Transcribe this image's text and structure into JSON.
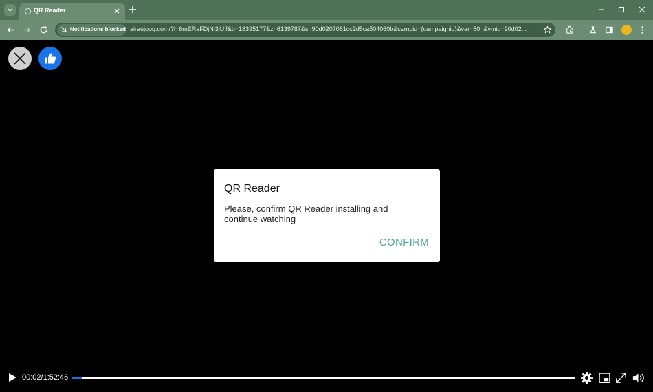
{
  "browser": {
    "tab_title": "QR Reader",
    "notification_chip": "Notifications blocked",
    "url": "airaujoog.com/?l=6mERaFDjNi3jUfl&b=18395177&z=6139787&s=90d0207061cc2d5ca504060b&campid={campaignid}&var=80_&ymid=90d02...",
    "icons": [
      "tab-search-icon",
      "close-icon",
      "plus-icon",
      "minimize-icon",
      "maximize-icon",
      "window-close-icon",
      "back-icon",
      "forward-icon",
      "reload-icon",
      "bell-off-icon",
      "star-icon",
      "extensions-icon",
      "labs-icon",
      "side-panel-icon",
      "menu-icon"
    ]
  },
  "page": {
    "close_icon": "close-icon",
    "like_icon": "thumbs-up-icon"
  },
  "dialog": {
    "title": "QR Reader",
    "body": "Please, confirm QR Reader installing and continue watching",
    "confirm_label": "CONFIRM"
  },
  "player": {
    "time": "00:02/1:52:46",
    "progress": 0.02,
    "accent_color": "#1a73e8"
  }
}
